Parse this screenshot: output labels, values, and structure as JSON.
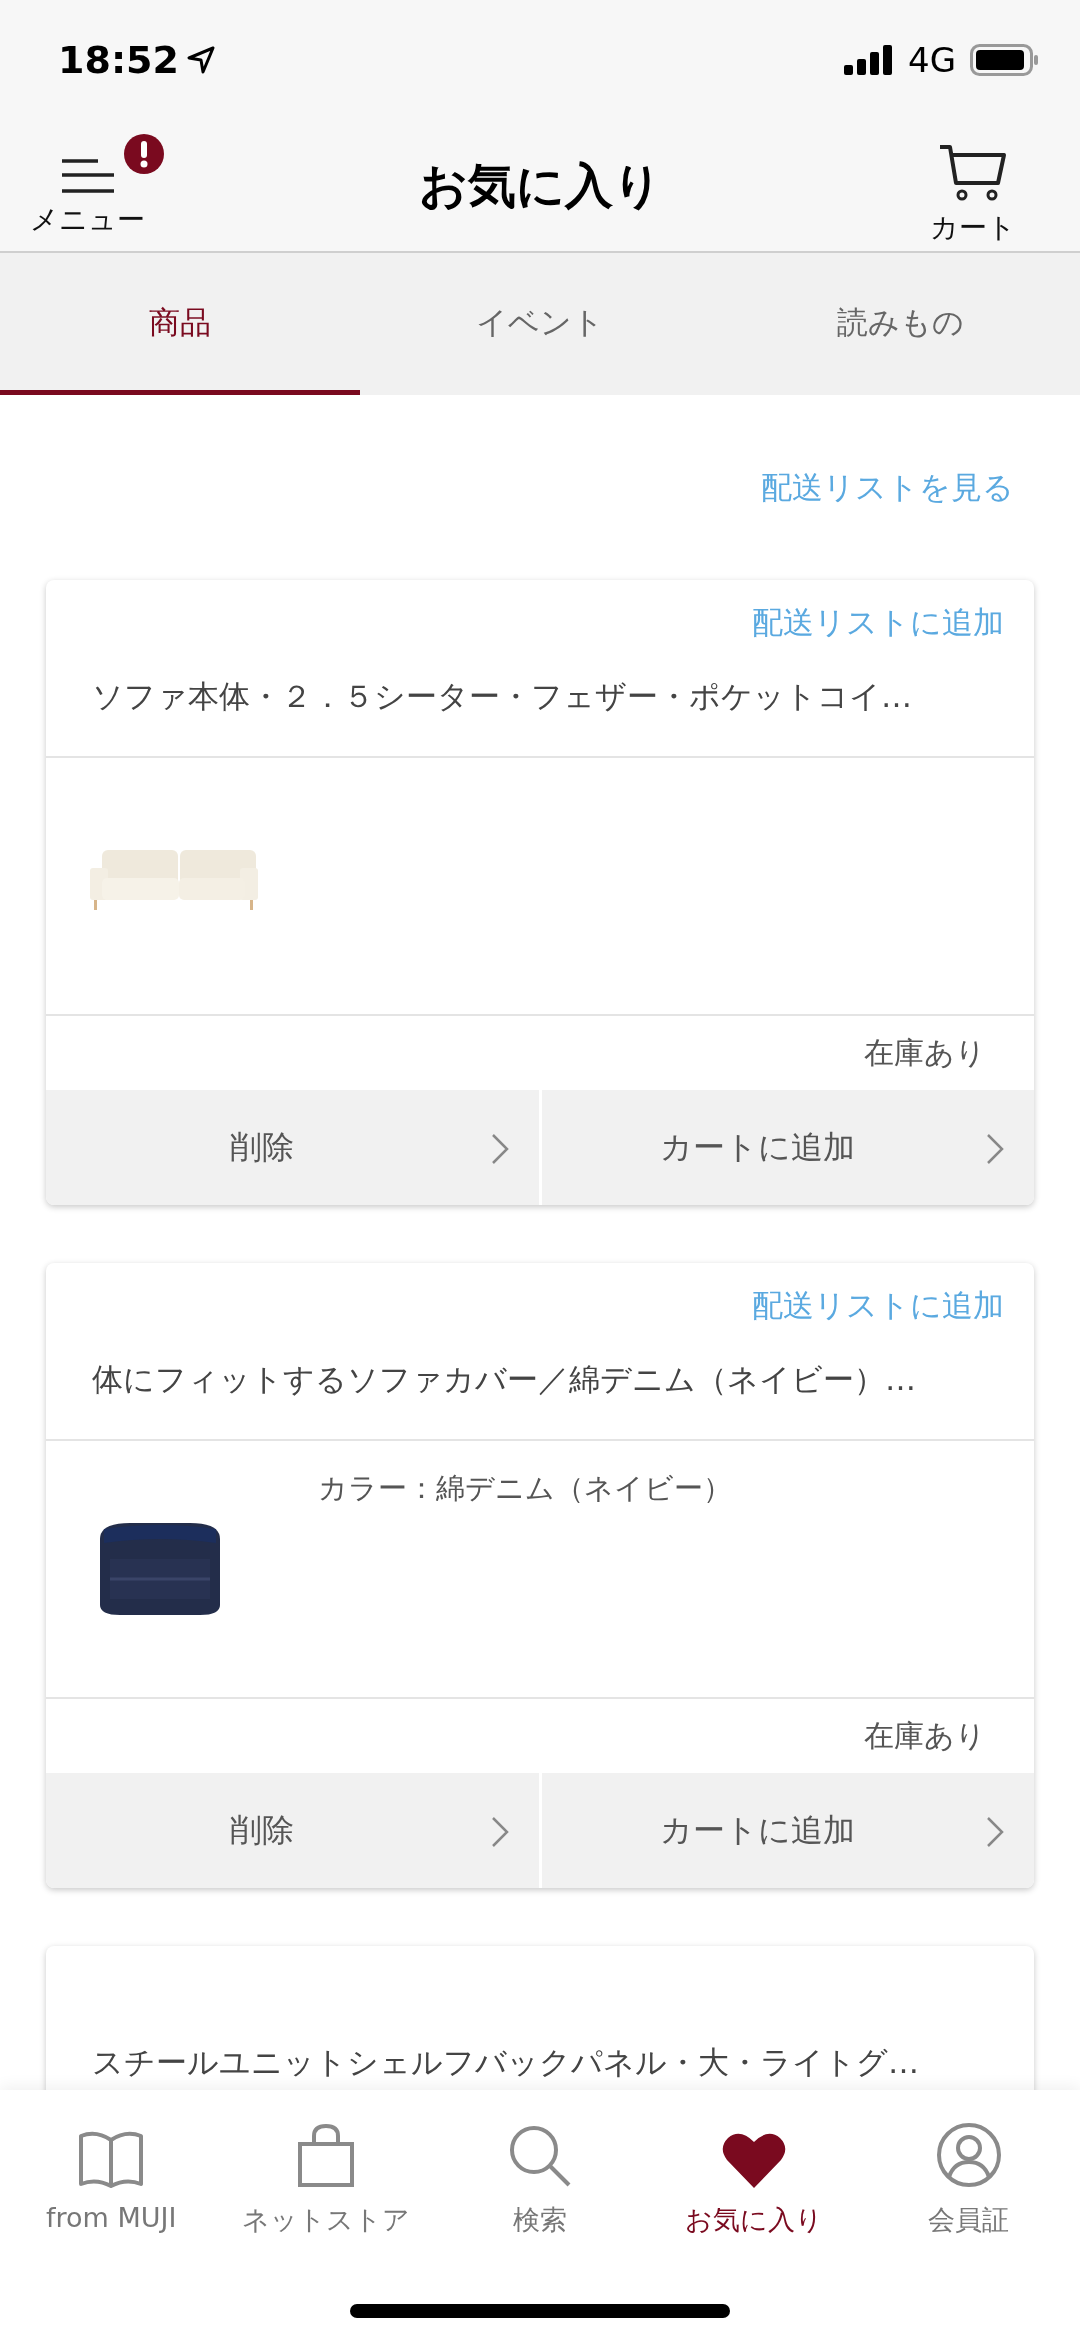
{
  "status_bar": {
    "time": "18:52",
    "network": "4G"
  },
  "header": {
    "menu_label": "メニュー",
    "menu_alert": true,
    "title": "お気に入り",
    "cart_label": "カート"
  },
  "tabs": [
    {
      "label": "商品",
      "selected": true
    },
    {
      "label": "イベント",
      "selected": false
    },
    {
      "label": "読みもの",
      "selected": false
    }
  ],
  "delivery_list_link": "配送リストを見る",
  "items": [
    {
      "add_link": "配送リストに追加",
      "name": "ソファ本体・２．５シーター・フェザー・ポケットコイ…",
      "image": {
        "kind": "picture"
      },
      "stock": "在庫あり",
      "buttons": [
        "削除",
        "カートに追加"
      ]
    },
    {
      "add_link": "配送リストに追加",
      "name": "体にフィットするソファカバー／綿デニム（ネイビー）…",
      "image": {
        "kind": "picture"
      },
      "variant": "カラー：綿デニム（ネイビー）",
      "stock": "在庫あり",
      "buttons": [
        "削除",
        "カートに追加"
      ]
    },
    {
      "name": "スチールユニットシェルフバックパネル・大・ライトグ…"
    }
  ],
  "bottom_nav": [
    {
      "label": "from MUJI",
      "selected": false
    },
    {
      "label": "ネットストア",
      "selected": false
    },
    {
      "label": "検索",
      "selected": false
    },
    {
      "label": "お気に入り",
      "selected": true
    },
    {
      "label": "会員証",
      "selected": false
    }
  ]
}
